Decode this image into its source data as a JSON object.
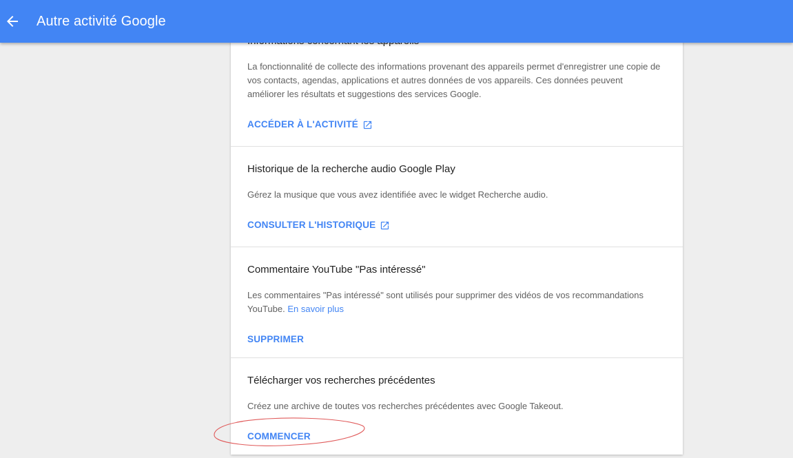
{
  "appbar": {
    "title": "Autre activité Google",
    "back_icon": "arrow-back-icon",
    "background_color": "#4285f4"
  },
  "sections": [
    {
      "title": "Informations concernant les appareils",
      "description": "La fonctionnalité de collecte des informations provenant des appareils permet d'enregistrer une copie de vos contacts, agendas, applications et autres données de vos appareils. Ces données peuvent améliorer les résultats et suggestions des services Google.",
      "action": "ACCÉDER À L'ACTIVITÉ",
      "action_icon": "open-in-new-icon"
    },
    {
      "title": "Historique de la recherche audio Google Play",
      "description": "Gérez la musique que vous avez identifiée avec le widget Recherche audio.",
      "action": "CONSULTER L'HISTORIQUE",
      "action_icon": "open-in-new-icon"
    },
    {
      "title": "Commentaire YouTube \"Pas intéressé\"",
      "description": "Les commentaires \"Pas intéressé\" sont utilisés pour supprimer des vidéos de vos recommandations YouTube.",
      "link": "En savoir plus",
      "action": "SUPPRIMER"
    },
    {
      "title": "Télécharger vos recherches précédentes",
      "description": "Créez une archive de toutes vos recherches précédentes avec Google Takeout.",
      "action": "COMMENCER",
      "annotation": "red-ellipse-highlight"
    }
  ],
  "colors": {
    "accent": "#4285f4",
    "title_text": "#212121",
    "body_text": "#616161",
    "annotation": "#e05a5a"
  }
}
